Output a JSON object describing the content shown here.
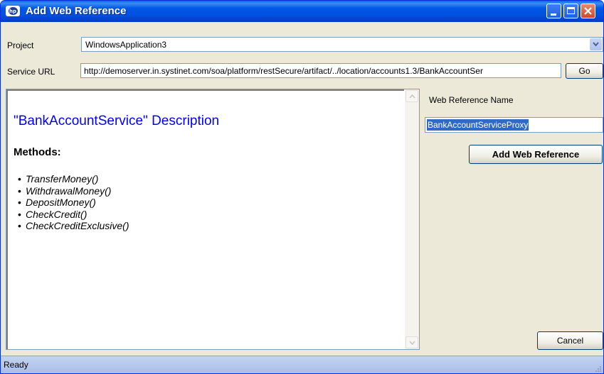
{
  "window": {
    "title": "Add Web Reference"
  },
  "form": {
    "project_label": "Project",
    "project_value": "WindowsApplication3",
    "service_url_label": "Service URL",
    "service_url_value": "http://demoserver.in.systinet.com/soa/platform/restSecure/artifact/../location/accounts1.3/BankAccountSer",
    "go_label": "Go"
  },
  "browser": {
    "title": "\"BankAccountService\" Description",
    "methods_label": "Methods:",
    "methods": [
      "TransferMoney()",
      "WithdrawalMoney()",
      "DepositMoney()",
      "CheckCredit()",
      "CheckCreditExclusive()"
    ]
  },
  "reference": {
    "name_label": "Web Reference Name",
    "name_value": "BankAccountServiceProxy",
    "add_label": "Add Web Reference",
    "cancel_label": "Cancel"
  },
  "status": {
    "text": "Ready"
  },
  "icons": {
    "app": "hp-logo-icon",
    "minimize": "minimize-icon",
    "maximize": "maximize-icon",
    "close": "close-icon",
    "dropdown": "chevron-down-icon",
    "scroll_up": "scroll-up-icon",
    "scroll_down": "scroll-down-icon",
    "grip": "resize-grip-icon"
  },
  "colors": {
    "titlebar": "#0058E6",
    "link_title": "#0000FF",
    "selection": "#316AC5",
    "window_bg": "#ECE9D8"
  }
}
